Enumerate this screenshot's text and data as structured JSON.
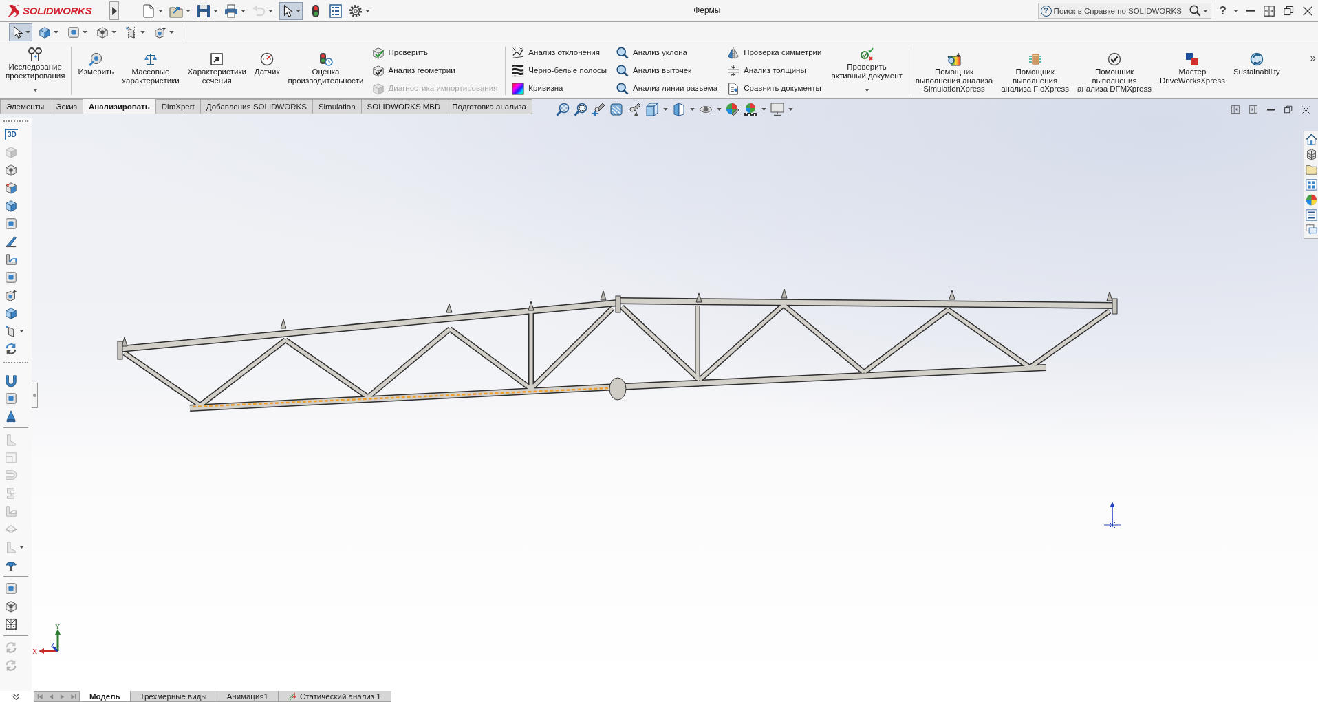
{
  "title_bar": {
    "logo_text": "SOLIDWORKS",
    "select_tool_pressed": true,
    "document_title": "Фермы",
    "help_search": {
      "glyph": "?",
      "placeholder": "Поиск в Справке по SOLIDWORKS"
    },
    "help_button": "?"
  },
  "selection_toolbar": {
    "select_tool_pressed": true
  },
  "command_manager": {
    "groups": [
      {
        "items": [
          {
            "kind": "large",
            "label": "Исследование\nпроектирования",
            "dropdown": true
          }
        ]
      },
      {
        "items": [
          {
            "kind": "large",
            "label": "Измерить",
            "dropdown": false
          },
          {
            "kind": "large",
            "label": "Массовые\nхарактеристики",
            "dropdown": false
          },
          {
            "kind": "large",
            "label": "Характеристики\nсечения",
            "dropdown": false
          },
          {
            "kind": "large",
            "label": "Датчик",
            "dropdown": false
          },
          {
            "kind": "large",
            "label": "Оценка\nпроизводительности",
            "dropdown": false
          },
          {
            "kind": "column",
            "items": [
              {
                "label": "Проверить",
                "disabled": false
              },
              {
                "label": "Анализ геометрии",
                "disabled": false
              },
              {
                "label": "Диагностика импортирования",
                "disabled": true
              }
            ]
          }
        ]
      },
      {
        "items": [
          {
            "kind": "column",
            "items": [
              {
                "label": "Анализ отклонения",
                "disabled": false
              },
              {
                "label": "Черно-белые полосы",
                "disabled": false
              },
              {
                "label": "Кривизна",
                "disabled": false
              }
            ]
          },
          {
            "kind": "column",
            "items": [
              {
                "label": "Анализ уклона",
                "disabled": false
              },
              {
                "label": "Анализ выточек",
                "disabled": false
              },
              {
                "label": "Анализ линии разъема",
                "disabled": false
              }
            ]
          },
          {
            "kind": "column",
            "items": [
              {
                "label": "Проверка симметрии",
                "disabled": false
              },
              {
                "label": "Анализ толщины",
                "disabled": false
              },
              {
                "label": "Сравнить документы",
                "disabled": false
              }
            ]
          },
          {
            "kind": "large",
            "label": "Проверить\nактивный документ",
            "dropdown": true
          }
        ]
      },
      {
        "items": [
          {
            "kind": "large",
            "label": "Помощник\nвыполнения анализа\nSimulationXpress",
            "dropdown": false
          },
          {
            "kind": "large",
            "label": "Помощник\nвыполнения\nанализа FloXpress",
            "dropdown": false
          },
          {
            "kind": "large",
            "label": "Помощник\nвыполнения\nанализа DFMXpress",
            "dropdown": false
          },
          {
            "kind": "large",
            "label": "Мастер\nDriveWorksXpress",
            "dropdown": false
          },
          {
            "kind": "large",
            "label": "Sustainability",
            "dropdown": false
          }
        ]
      }
    ],
    "overflow": "»"
  },
  "tabs": [
    {
      "label": "Элементы",
      "selected": false
    },
    {
      "label": "Эскиз",
      "selected": false
    },
    {
      "label": "Анализировать",
      "selected": true
    },
    {
      "label": "DimXpert",
      "selected": false
    },
    {
      "label": "Добавления SOLIDWORKS",
      "selected": false
    },
    {
      "label": "Simulation",
      "selected": false
    },
    {
      "label": "SOLIDWORKS MBD",
      "selected": false
    },
    {
      "label": "Подготовка анализа",
      "selected": false
    }
  ],
  "left_toolbar": {
    "groups": [
      {
        "items": [
          {
            "kind": "text",
            "label": "3D",
            "disabled": false
          },
          {
            "kind": "icon",
            "disabled": true
          },
          {
            "kind": "icon",
            "disabled": false
          },
          {
            "kind": "icon",
            "disabled": false
          },
          {
            "kind": "icon",
            "disabled": false
          },
          {
            "kind": "icon",
            "disabled": false
          },
          {
            "kind": "icon",
            "disabled": false
          },
          {
            "kind": "icon",
            "disabled": false
          },
          {
            "kind": "icon",
            "disabled": false
          },
          {
            "kind": "icon",
            "disabled": false
          },
          {
            "kind": "icon",
            "disabled": false
          },
          {
            "kind": "flyout",
            "disabled": false
          },
          {
            "kind": "icon",
            "disabled": false
          }
        ]
      },
      {
        "items": [
          {
            "kind": "icon",
            "disabled": false
          },
          {
            "kind": "icon",
            "disabled": false
          },
          {
            "kind": "icon",
            "disabled": false
          }
        ]
      },
      {
        "items": [
          {
            "kind": "icon",
            "disabled": true
          },
          {
            "kind": "icon",
            "disabled": true
          },
          {
            "kind": "icon",
            "disabled": true
          },
          {
            "kind": "icon",
            "disabled": true
          },
          {
            "kind": "icon",
            "disabled": true
          },
          {
            "kind": "icon",
            "disabled": true
          },
          {
            "kind": "flyout",
            "disabled": true
          },
          {
            "kind": "icon",
            "disabled": false
          }
        ]
      },
      {
        "items": [
          {
            "kind": "icon",
            "disabled": false
          },
          {
            "kind": "icon",
            "disabled": false
          },
          {
            "kind": "icon",
            "disabled": false
          }
        ]
      },
      {
        "items": [
          {
            "kind": "icon",
            "disabled": true
          },
          {
            "kind": "icon",
            "disabled": true
          }
        ]
      }
    ]
  },
  "triad": {
    "x_label": "X",
    "y_label": "Y",
    "z_label": "Z"
  },
  "bottom_tabs": [
    {
      "kind": "sheet",
      "label": "Модель",
      "selected": true
    },
    {
      "kind": "sheet",
      "label": "Трехмерные виды",
      "selected": false
    },
    {
      "kind": "sheet",
      "label": "Анимация1",
      "selected": false
    },
    {
      "kind": "study",
      "label": "Статический анализ 1",
      "selected": false
    }
  ]
}
